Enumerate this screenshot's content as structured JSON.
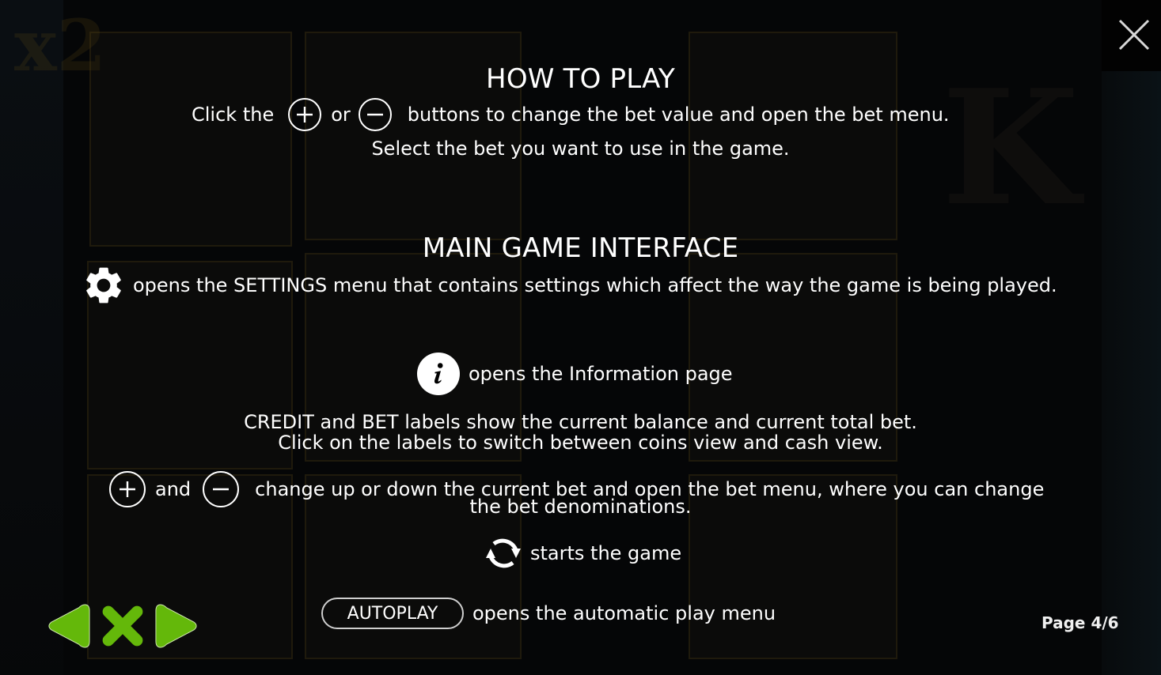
{
  "colors": {
    "text": "#ffffff",
    "nav_green": "#64b80a",
    "background": "#050607",
    "autoplay_border": "#cfcfcf"
  },
  "how_to_play": {
    "title": "HOW TO PLAY",
    "line1_prefix": "Click the",
    "line1_or": "or",
    "line1_suffix": "buttons to change the bet value and open the bet menu.",
    "line2": "Select the bet you want to use in the game."
  },
  "main_interface": {
    "title": "MAIN GAME INTERFACE",
    "settings_text": "opens the SETTINGS menu that contains settings which affect the way the game is being played.",
    "info_text": "opens the Information page",
    "credit_line1": "CREDIT and BET labels show the current balance and current total bet.",
    "credit_line2": "Click on the labels to switch between coins view and cash view.",
    "bet_and": "and",
    "bet_line1": "change up or down the current bet and open the bet menu, where you can change",
    "bet_line2": "the bet denominations.",
    "spin_text": "starts the game",
    "autoplay_label": "AUTOPLAY",
    "autoplay_text": "opens the automatic play menu"
  },
  "icons": {
    "plus": "plus-circle-icon",
    "minus": "minus-circle-icon",
    "settings": "gear-icon",
    "info": "info-icon",
    "spin": "refresh-icon",
    "close": "close-icon",
    "prev": "arrow-left-icon",
    "nav_close": "x-icon",
    "next": "arrow-right-icon"
  },
  "pagination": {
    "label": "Page 4/6",
    "current": 4,
    "total": 6
  }
}
